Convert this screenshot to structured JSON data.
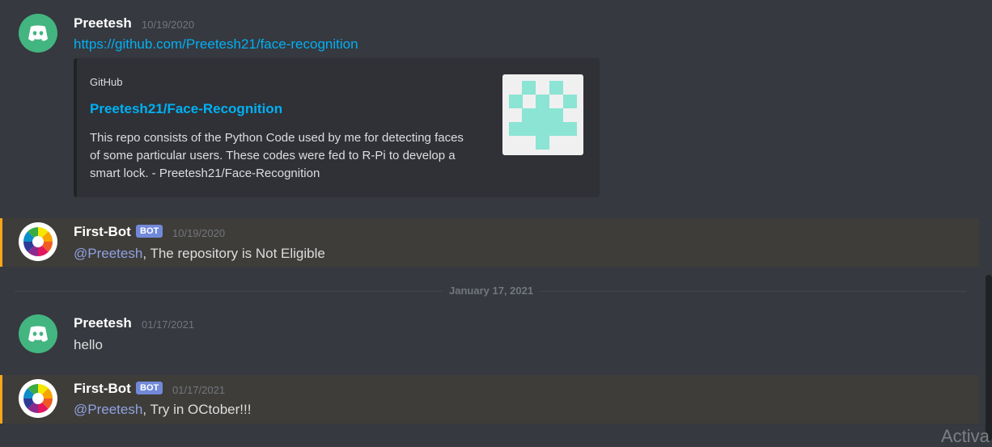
{
  "messages": [
    {
      "author": "Preetesh",
      "timestamp": "10/19/2020",
      "link": "https://github.com/Preetesh21/face-recognition",
      "embed": {
        "provider": "GitHub",
        "title": "Preetesh21/Face-Recognition",
        "description": "This repo consists of the Python Code used by me for detecting faces of some particular users. These codes were fed to R-Pi to develop a smart lock. - Preetesh21/Face-Recognition"
      }
    },
    {
      "author": "First-Bot",
      "bot_tag": "BOT",
      "timestamp": "10/19/2020",
      "mention": "@Preetesh",
      "text": ", The repository is Not Eligible"
    },
    {
      "author": "Preetesh",
      "timestamp": "01/17/2021",
      "text": "hello"
    },
    {
      "author": "First-Bot",
      "bot_tag": "BOT",
      "timestamp": "01/17/2021",
      "mention": "@Preetesh",
      "text": ", Try in OCtober!!!"
    }
  ],
  "date_divider": "January 17, 2021",
  "watermark": "Activa",
  "colors": {
    "background": "#36393f",
    "mention_highlight": "#faa61a",
    "link": "#00b0f4",
    "bot_tag": "#7289da",
    "discord_avatar": "#43b581",
    "identicon": "#8be4d4"
  },
  "icons": {
    "preetesh_avatar": "discord-logo-icon",
    "bot_avatar": "color-wheel-icon",
    "embed_thumbnail": "github-identicon"
  }
}
